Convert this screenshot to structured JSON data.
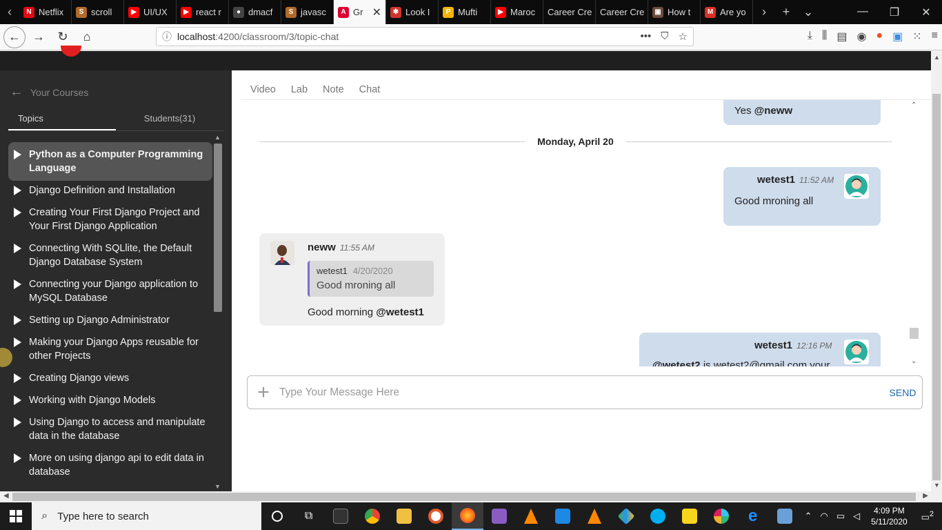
{
  "browser": {
    "tabs": [
      {
        "label": "Netflix",
        "color": "#e50914",
        "glyph": "N"
      },
      {
        "label": "scroll",
        "color": "#b06a2a",
        "glyph": "S"
      },
      {
        "label": "UI/UX",
        "color": "#ff0000",
        "glyph": "▶"
      },
      {
        "label": "react r",
        "color": "#ff0000",
        "glyph": "▶"
      },
      {
        "label": "dmacf",
        "color": "#444444",
        "glyph": "●"
      },
      {
        "label": "javasc",
        "color": "#b06a2a",
        "glyph": "S"
      },
      {
        "label": "Gr",
        "color": "#dd0031",
        "glyph": "A",
        "active": true
      },
      {
        "label": "Look I",
        "color": "#d0342c",
        "glyph": "✱"
      },
      {
        "label": "Mufti",
        "color": "#f4b400",
        "glyph": "P"
      },
      {
        "label": "Maroc",
        "color": "#ff0000",
        "glyph": "▶"
      },
      {
        "label": "Career Cre",
        "color": "",
        "glyph": ""
      },
      {
        "label": "Career Cre",
        "color": "",
        "glyph": ""
      },
      {
        "label": "How t",
        "color": "#6a4a3a",
        "glyph": "▣"
      },
      {
        "label": "Are yo",
        "color": "#d93025",
        "glyph": "M"
      }
    ],
    "url_host": "localhost",
    "url_path": ":4200/classroom/3/topic-chat"
  },
  "sidebar": {
    "back_label": "Your Courses",
    "tab_topics": "Topics",
    "tab_students": "Students(31)",
    "topics": [
      "Python as a Computer Programming Language",
      "Django Definition and Installation",
      "Creating Your First Django Project and Your First Django Application",
      "Connecting With SQLlite, the Default Django Database System",
      "Connecting your Django application to MySQL Database",
      "Setting up Django Administrator",
      "Making your Django Apps reusable for other Projects",
      "Creating Django views",
      "Working with Django Models",
      "Using Django to access and manipulate data in the database",
      "More on using django api to edit data in database"
    ]
  },
  "content_tabs": [
    "Video",
    "Lab",
    "Note",
    "Chat"
  ],
  "chat": {
    "msg0": {
      "text": "Yes ",
      "mention": "@neww"
    },
    "date_separator": "Monday, April 20",
    "msg1": {
      "name": "wetest1",
      "time": "11:52 AM",
      "text": "Good mroning all"
    },
    "msg2": {
      "name": "neww",
      "time": "11:55 AM",
      "quote_name": "wetest1",
      "quote_date": "4/20/2020",
      "quote_text": "Good mroning all",
      "text": "Good morning ",
      "mention": "@wetest1"
    },
    "msg3": {
      "name": "wetest1",
      "time": "12:16 PM",
      "mention": "@wetest2",
      "text": " is wetest2@gmail.com your"
    }
  },
  "composer": {
    "placeholder": "Type Your Message Here",
    "send_label": "SEND"
  },
  "taskbar": {
    "search_placeholder": "Type here to search",
    "time": "4:09 PM",
    "date": "5/11/2020",
    "notifications": "2"
  }
}
